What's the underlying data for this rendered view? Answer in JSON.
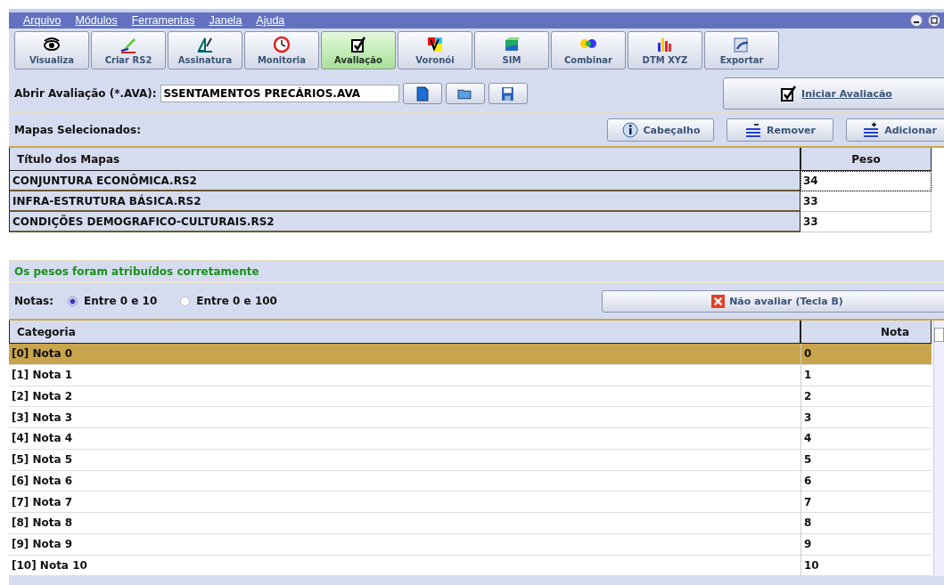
{
  "menu": [
    "Arquivo",
    "Módulos",
    "Ferramentas",
    "Janela",
    "Ajuda"
  ],
  "toolbar": [
    {
      "label": "Visualiza",
      "selected": false
    },
    {
      "label": "Criar RS2",
      "selected": false
    },
    {
      "label": "Assinatura",
      "selected": false
    },
    {
      "label": "Monitoria",
      "selected": false
    },
    {
      "label": "Avaliação",
      "selected": true
    },
    {
      "label": "Voronói",
      "selected": false
    },
    {
      "label": "SIM",
      "selected": false
    },
    {
      "label": "Combinar",
      "selected": false
    },
    {
      "label": "DTM XYZ",
      "selected": false
    },
    {
      "label": "Exportar",
      "selected": false
    }
  ],
  "open_file": {
    "label": "Abrir Avaliação (*.AVA):",
    "value": "SSENTAMENTOS PRECÁRIOS.AVA"
  },
  "start_button": "Iniciar Avaliação",
  "maps": {
    "label": "Mapas Selecionados:",
    "buttons": [
      "Cabeçalho",
      "Remover",
      "Adicionar"
    ],
    "columns": [
      "Título dos Mapas",
      "Peso"
    ],
    "rows": [
      {
        "title": "CONJUNTURA ECONÔMICA.RS2",
        "weight": "34",
        "selected": true
      },
      {
        "title": "INFRA-ESTRUTURA BÁSICA.RS2",
        "weight": "33",
        "selected": false
      },
      {
        "title": "CONDIÇÕES DEMOGRAFICO-CULTURAIS.RS2",
        "weight": "33",
        "selected": false
      }
    ]
  },
  "status_message": "Os pesos foram atribuídos corretamente",
  "grades": {
    "label": "Notas:",
    "options": [
      {
        "label": "Entre 0 e 10",
        "selected": true
      },
      {
        "label": "Entre 0 e 100",
        "selected": false
      }
    ],
    "skip_button": "Não avaliar (Tecla B)",
    "columns": [
      "Categoria",
      "Nota"
    ],
    "rows": [
      {
        "category": "[0] Nota 0",
        "grade": "0",
        "selected": true
      },
      {
        "category": "[1] Nota 1",
        "grade": "1",
        "selected": false
      },
      {
        "category": "[2] Nota 2",
        "grade": "2",
        "selected": false
      },
      {
        "category": "[3] Nota 3",
        "grade": "3",
        "selected": false
      },
      {
        "category": "[4] Nota 4",
        "grade": "4",
        "selected": false
      },
      {
        "category": "[5] Nota 5",
        "grade": "5",
        "selected": false
      },
      {
        "category": "[6] Nota 6",
        "grade": "6",
        "selected": false
      },
      {
        "category": "[7] Nota 7",
        "grade": "7",
        "selected": false
      },
      {
        "category": "[8] Nota 8",
        "grade": "8",
        "selected": false
      },
      {
        "category": "[9] Nota 9",
        "grade": "9",
        "selected": false
      },
      {
        "category": "[10] Nota 10",
        "grade": "10",
        "selected": false
      }
    ]
  }
}
